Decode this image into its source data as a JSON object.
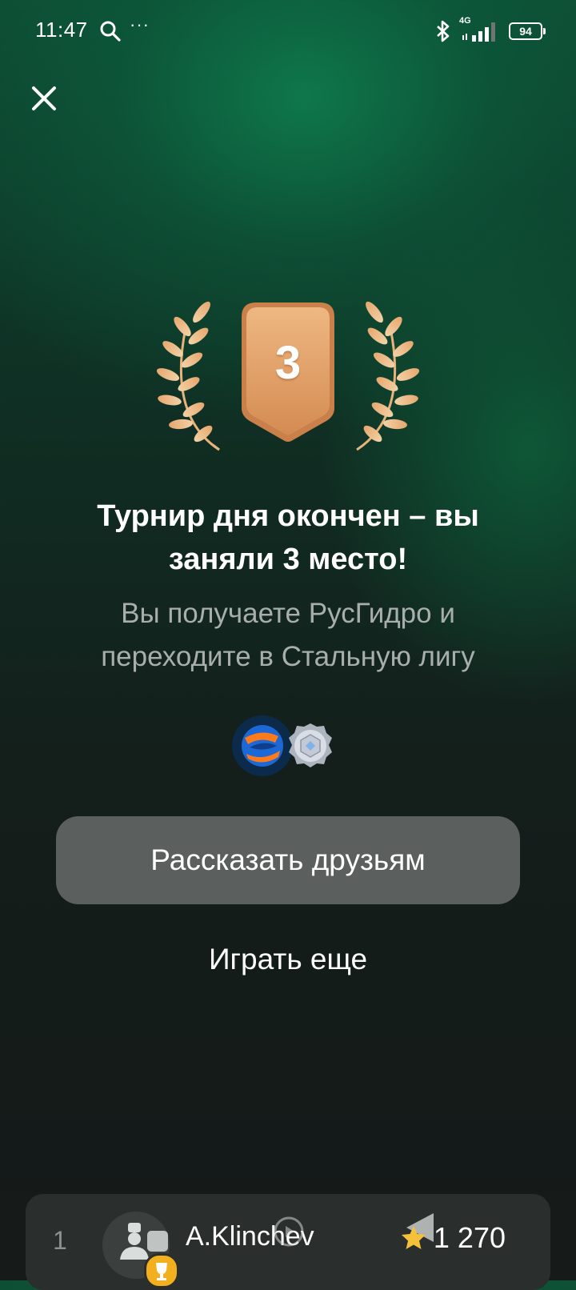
{
  "status_bar": {
    "time": "11:47",
    "dots": "···",
    "network": "4G",
    "battery": "94",
    "icons": [
      "search-icon",
      "bluetooth-icon",
      "signal-icon",
      "battery-icon"
    ]
  },
  "header": {
    "close_icon": "close-icon"
  },
  "result": {
    "place": "3",
    "title_line1": "Турнир дня окончен – вы",
    "title_line2": "заняли 3 место!",
    "subtitle_line1": "Вы получаете РусГидро и",
    "subtitle_line2": "переходите в Стальную лигу",
    "reward_icons": [
      "rushydro-logo-icon",
      "steel-league-badge-icon"
    ]
  },
  "actions": {
    "share_label": "Рассказать друзьям",
    "play_again_label": "Играть еще"
  },
  "leaderboard": {
    "rows": [
      {
        "rank": "1",
        "name": "A.Klinchev",
        "score": "1 270"
      }
    ]
  },
  "colors": {
    "accent_green": "#0e7a4c",
    "bronze": "#e0a36a",
    "button_bg": "#5b605e",
    "subtitle": "#a8aeac"
  }
}
